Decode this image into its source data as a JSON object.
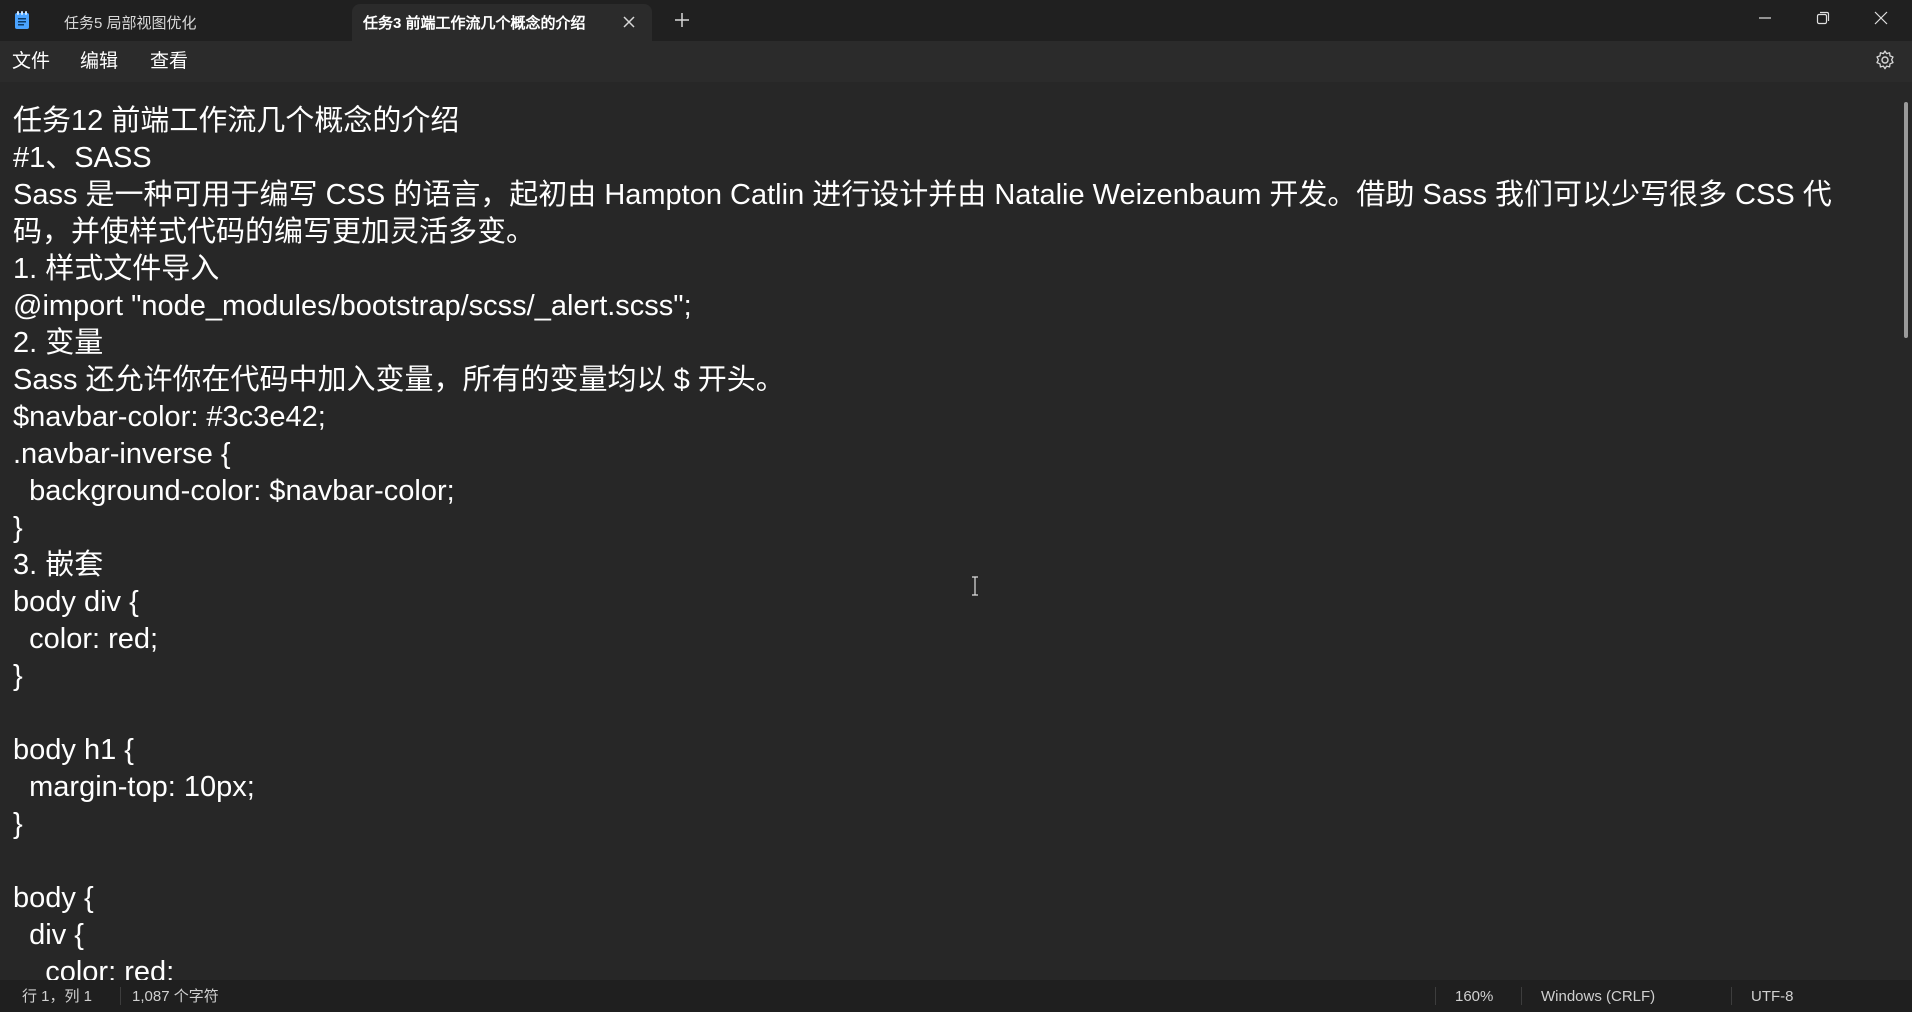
{
  "titlebar": {
    "tabs": [
      {
        "label": "任务5 局部视图优化",
        "active": false
      },
      {
        "label": "任务3 前端工作流几个概念的介绍",
        "active": true
      }
    ]
  },
  "menu": {
    "file": "文件",
    "edit": "编辑",
    "view": "查看"
  },
  "editor": {
    "lines": [
      "任务12 前端工作流几个概念的介绍",
      "#1、SASS",
      "Sass 是一种可用于编写 CSS 的语言，起初由 Hampton Catlin 进行设计并由 Natalie Weizenbaum 开发。借助 Sass 我们可以少写很多 CSS 代码，并使样式代码的编写更加灵活多变。",
      "1. 样式文件导入",
      "@import \"node_modules/bootstrap/scss/_alert.scss\";",
      "2. 变量",
      "Sass 还允许你在代码中加入变量，所有的变量均以 $ 开头。",
      "$navbar-color: #3c3e42;",
      ".navbar-inverse {",
      "  background-color: $navbar-color;",
      "}",
      "3. 嵌套",
      "body div {",
      "  color: red;",
      "}",
      "",
      "body h1 {",
      "  margin-top: 10px;",
      "}",
      "",
      "body {",
      "  div {",
      "    color: red;"
    ]
  },
  "statusbar": {
    "position": "行 1，列 1",
    "char_count": "1,087 个字符",
    "zoom": "160%",
    "line_ending": "Windows (CRLF)",
    "encoding": "UTF-8"
  },
  "colors": {
    "titlebar_bg": "#202020",
    "editor_bg": "#272727",
    "statusbar_bg": "#1f1f1f",
    "app_icon": "#4aa3ff"
  }
}
